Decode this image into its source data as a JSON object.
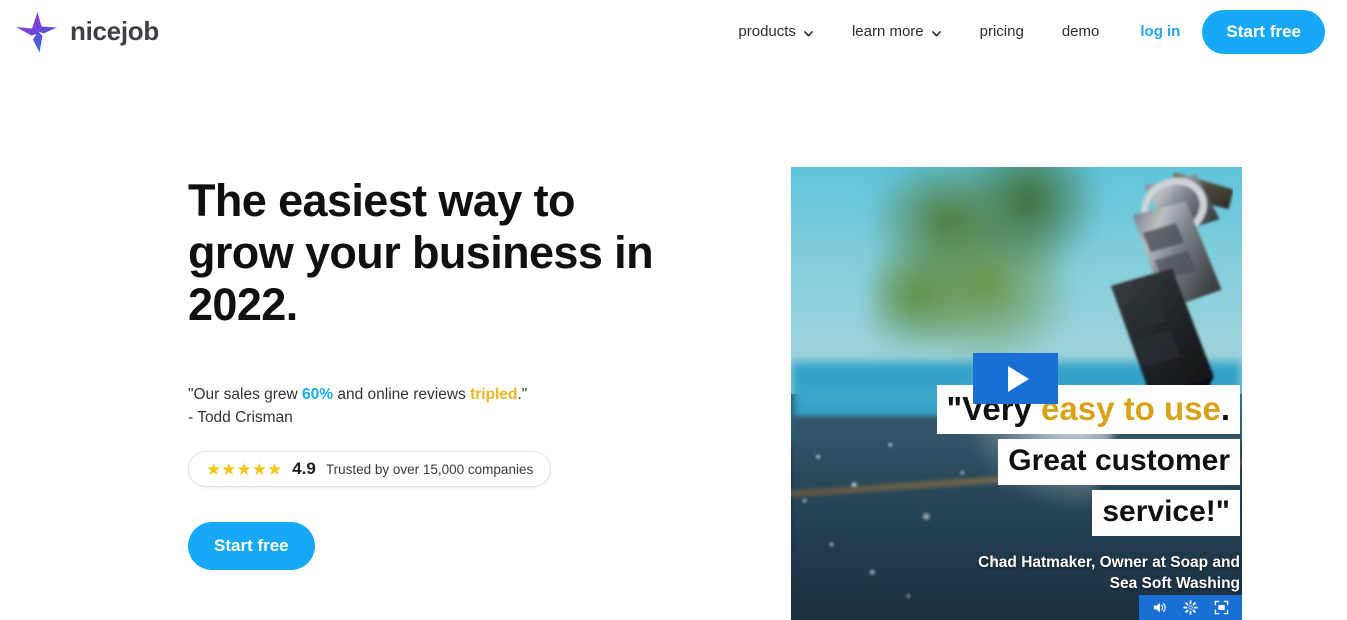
{
  "brand": {
    "name": "nicejob",
    "logo_icon": "nicejob-star-logo",
    "gradient_from": "#8b35d6",
    "gradient_to": "#2f6fe0"
  },
  "nav": {
    "items": [
      {
        "label": "products",
        "has_caret": true
      },
      {
        "label": "learn more",
        "has_caret": true
      },
      {
        "label": "pricing",
        "has_caret": false
      },
      {
        "label": "demo",
        "has_caret": false
      }
    ],
    "login_label": "log in",
    "cta_label": "Start free",
    "cta_color": "#17a9f7",
    "login_color": "#20a4f3"
  },
  "hero": {
    "headline": "The easiest way to grow your business in 2022.",
    "quote_prefix": "\"Our sales grew ",
    "quote_metric": "60%",
    "quote_middle": " and online reviews ",
    "quote_highlight": "tripled",
    "quote_suffix": ".\"",
    "quote_author": "- Todd Crisman",
    "metric_color": "#17a9f7",
    "highlight_color": "#f0b422",
    "rating": {
      "stars": "★★★★★",
      "score": "4.9",
      "text": "Trusted by over 15,000 companies",
      "star_color": "#f5c518"
    },
    "cta_label": "Start free"
  },
  "video": {
    "play_label": "play-video",
    "thumbnail_description": "pressure washer nozzle spraying a deck",
    "caption_line1_black": "\"Very",
    "caption_line1_gold": " easy to use",
    "caption_line1_end": ".",
    "caption_line2": "Great customer",
    "caption_line3": "service!\"",
    "attribution_line1": "Chad Hatmaker, Owner at Soap and",
    "attribution_line2": "Sea Soft Washing",
    "caption_gold_color": "#d9a319",
    "controls_bg": "#1a6fd4",
    "controls": [
      {
        "icon": "volume-icon"
      },
      {
        "icon": "settings-gear-icon"
      },
      {
        "icon": "fullscreen-icon"
      }
    ]
  }
}
